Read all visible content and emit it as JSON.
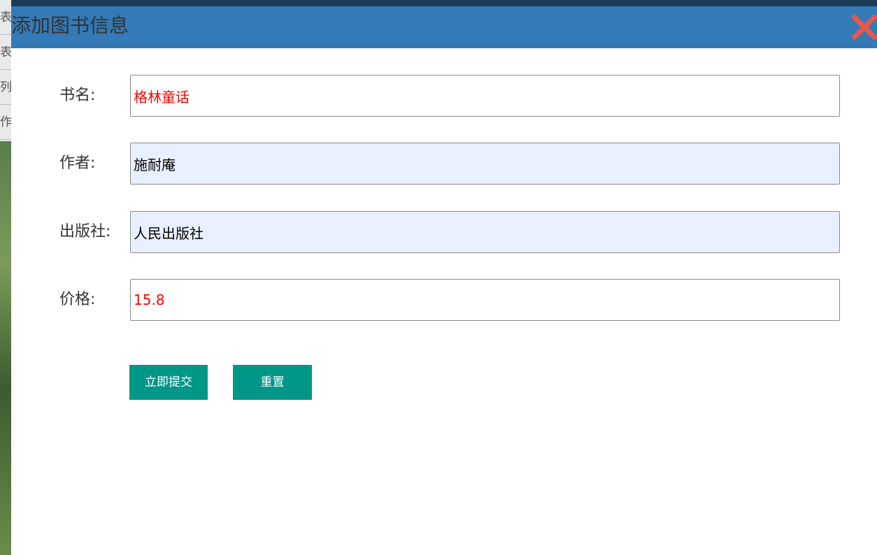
{
  "background": {
    "menu_items": [
      "表",
      "表",
      "列",
      "作"
    ]
  },
  "dialog": {
    "title": "添加图书信息",
    "close_icon": "close-icon",
    "fields": [
      {
        "label": "书名:",
        "value": "格林童话"
      },
      {
        "label": "作者:",
        "value": "施耐庵"
      },
      {
        "label": "出版社:",
        "value": "人民出版社"
      },
      {
        "label": "价格:",
        "value": "15.8"
      }
    ],
    "submit_label": "立即提交",
    "reset_label": "重置"
  },
  "colors": {
    "header": "#337ab7",
    "button": "#009688",
    "close": "#e8594a",
    "red_text": "#ff0000",
    "autofill_bg": "#e8f0fe"
  }
}
